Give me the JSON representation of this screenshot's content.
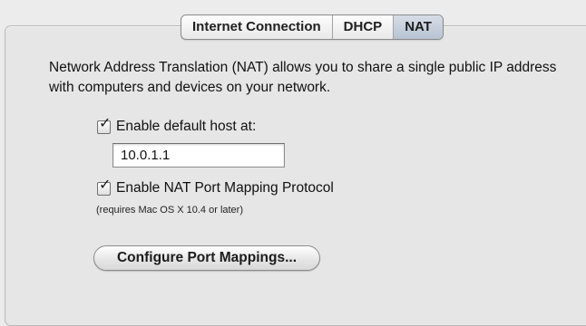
{
  "tabs": [
    {
      "label": "Internet Connection",
      "selected": false
    },
    {
      "label": "DHCP",
      "selected": false
    },
    {
      "label": "NAT",
      "selected": true
    }
  ],
  "description": "Network Address Translation (NAT) allows you to share a single public IP address with computers and devices on your network.",
  "default_host": {
    "checkbox_label": "Enable default host at:",
    "checked": true,
    "field_value": "10.0.1.1"
  },
  "nat_pmp": {
    "checkbox_label": "Enable NAT Port Mapping Protocol",
    "checked": true,
    "note": "(requires Mac OS X 10.4 or later)"
  },
  "configure_button": {
    "label": "Configure Port Mappings..."
  },
  "colors": {
    "selected_tab": "#c4cfdc",
    "panel_background": "#e6e6e6"
  }
}
